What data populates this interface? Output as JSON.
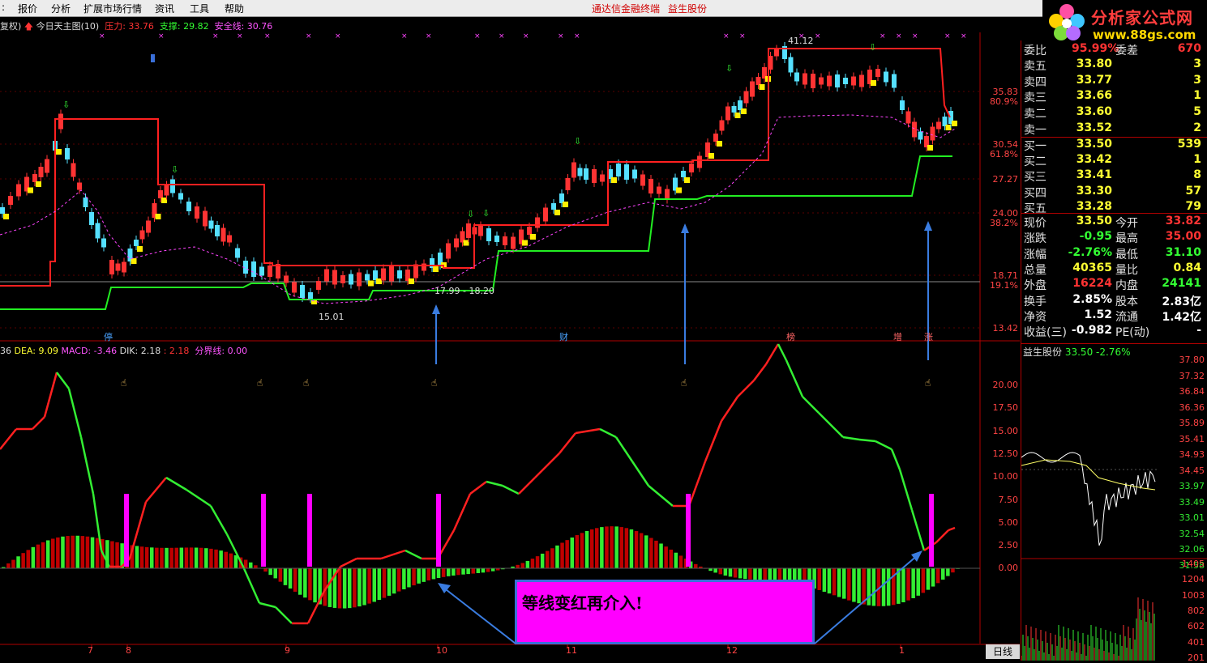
{
  "menu": {
    "items": [
      "报价",
      "分析",
      "扩展市场行情",
      "资讯",
      "工具",
      "帮助"
    ],
    "center_title": "通达信金融终端",
    "stock_name": "益生股份"
  },
  "logo": {
    "brand": "分析家公式网",
    "url": "www.88gs.com"
  },
  "chart_header": {
    "mode": "复权)",
    "title": "今日天主图(10)",
    "pressure": "压力: 33.76",
    "support": "支撑: 29.82",
    "safe_line": "安全线: 30.76"
  },
  "macd_header": {
    "diff": "36",
    "dea": "DEA: 9.09",
    "macd": "MACD: -3.46",
    "dik_label": "DIK: 2.18",
    "dik_val": ": 2.18",
    "divider": "分界线: 0.00"
  },
  "price_axis": [
    {
      "v": "35.83",
      "pct": "80.9%"
    },
    {
      "v": "30.54",
      "pct": "61.8%"
    },
    {
      "v": "27.27",
      "pct": ""
    },
    {
      "v": "24.00",
      "pct": "38.2%"
    },
    {
      "v": "18.71",
      "pct": "19.1%"
    },
    {
      "v": "13.42",
      "pct": ""
    }
  ],
  "macd_axis": [
    "20.00",
    "17.50",
    "15.00",
    "12.50",
    "10.00",
    "7.50",
    "5.00",
    "2.50",
    "0.00"
  ],
  "annotations": {
    "high_label": "41.12",
    "low_label": "15.01",
    "range_label": "17.99 - 18.20",
    "markers": [
      "停",
      "财",
      "榜",
      "增",
      "涨"
    ],
    "callout": "等线变红再介入!"
  },
  "dates": [
    "7",
    "8",
    "9",
    "10",
    "11",
    "12",
    "1"
  ],
  "daily_label": "日线",
  "order_book": {
    "ratio": {
      "label": "委比",
      "value": "95.99%",
      "diff_label": "委差",
      "diff": "670"
    },
    "asks": [
      {
        "label": "卖五",
        "price": "33.80",
        "vol": "3"
      },
      {
        "label": "卖四",
        "price": "33.77",
        "vol": "3"
      },
      {
        "label": "卖三",
        "price": "33.66",
        "vol": "1"
      },
      {
        "label": "卖二",
        "price": "33.60",
        "vol": "5"
      },
      {
        "label": "卖一",
        "price": "33.52",
        "vol": "2"
      }
    ],
    "bids": [
      {
        "label": "买一",
        "price": "33.50",
        "vol": "539"
      },
      {
        "label": "买二",
        "price": "33.42",
        "vol": "1"
      },
      {
        "label": "买三",
        "price": "33.41",
        "vol": "8"
      },
      {
        "label": "买四",
        "price": "33.30",
        "vol": "57"
      },
      {
        "label": "买五",
        "price": "33.28",
        "vol": "79"
      }
    ]
  },
  "quote": [
    {
      "l1": "现价",
      "v1": "33.50",
      "c1": "yellowV",
      "l2": "今开",
      "v2": "33.82",
      "c2": "redV"
    },
    {
      "l1": "涨跌",
      "v1": "-0.95",
      "c1": "greenV",
      "l2": "最高",
      "v2": "35.00",
      "c2": "redV"
    },
    {
      "l1": "涨幅",
      "v1": "-2.76%",
      "c1": "greenV",
      "l2": "最低",
      "v2": "31.10",
      "c2": "greenV"
    },
    {
      "l1": "总量",
      "v1": "40365",
      "c1": "yellowV",
      "l2": "量比",
      "v2": "0.84",
      "c2": "yellowV"
    },
    {
      "l1": "外盘",
      "v1": "16224",
      "c1": "redV",
      "l2": "内盘",
      "v2": "24141",
      "c2": "greenV"
    },
    {
      "l1": "换手",
      "v1": "2.85%",
      "c1": "whiteV",
      "l2": "股本",
      "v2": "2.83亿",
      "c2": "whiteV"
    },
    {
      "l1": "净资",
      "v1": "1.52",
      "c1": "whiteV",
      "l2": "流通",
      "v2": "1.42亿",
      "c2": "whiteV"
    },
    {
      "l1": "收益(三)",
      "v1": "-0.982",
      "c1": "whiteV",
      "l2": "PE(动)",
      "v2": "-",
      "c2": "whiteV"
    }
  ],
  "mini_chart": {
    "title": "益生股份",
    "price": "33.50",
    "change": "-2.76%",
    "price_axis": [
      "37.80",
      "37.32",
      "36.84",
      "36.36",
      "35.89",
      "35.41",
      "34.93",
      "34.45",
      "33.97",
      "33.49",
      "33.01",
      "32.54",
      "32.06",
      "31.58"
    ],
    "vol_axis": [
      "1405",
      "1204",
      "1003",
      "802",
      "602",
      "401",
      "201"
    ]
  },
  "colors": {
    "up": "#ff3333",
    "down": "#55e0ff",
    "yellow": "#ffee00",
    "pressure": "#ff2020",
    "support": "#22ee22",
    "accent_magenta": "#ff00ff",
    "arrow_blue": "#3a7ce0"
  }
}
